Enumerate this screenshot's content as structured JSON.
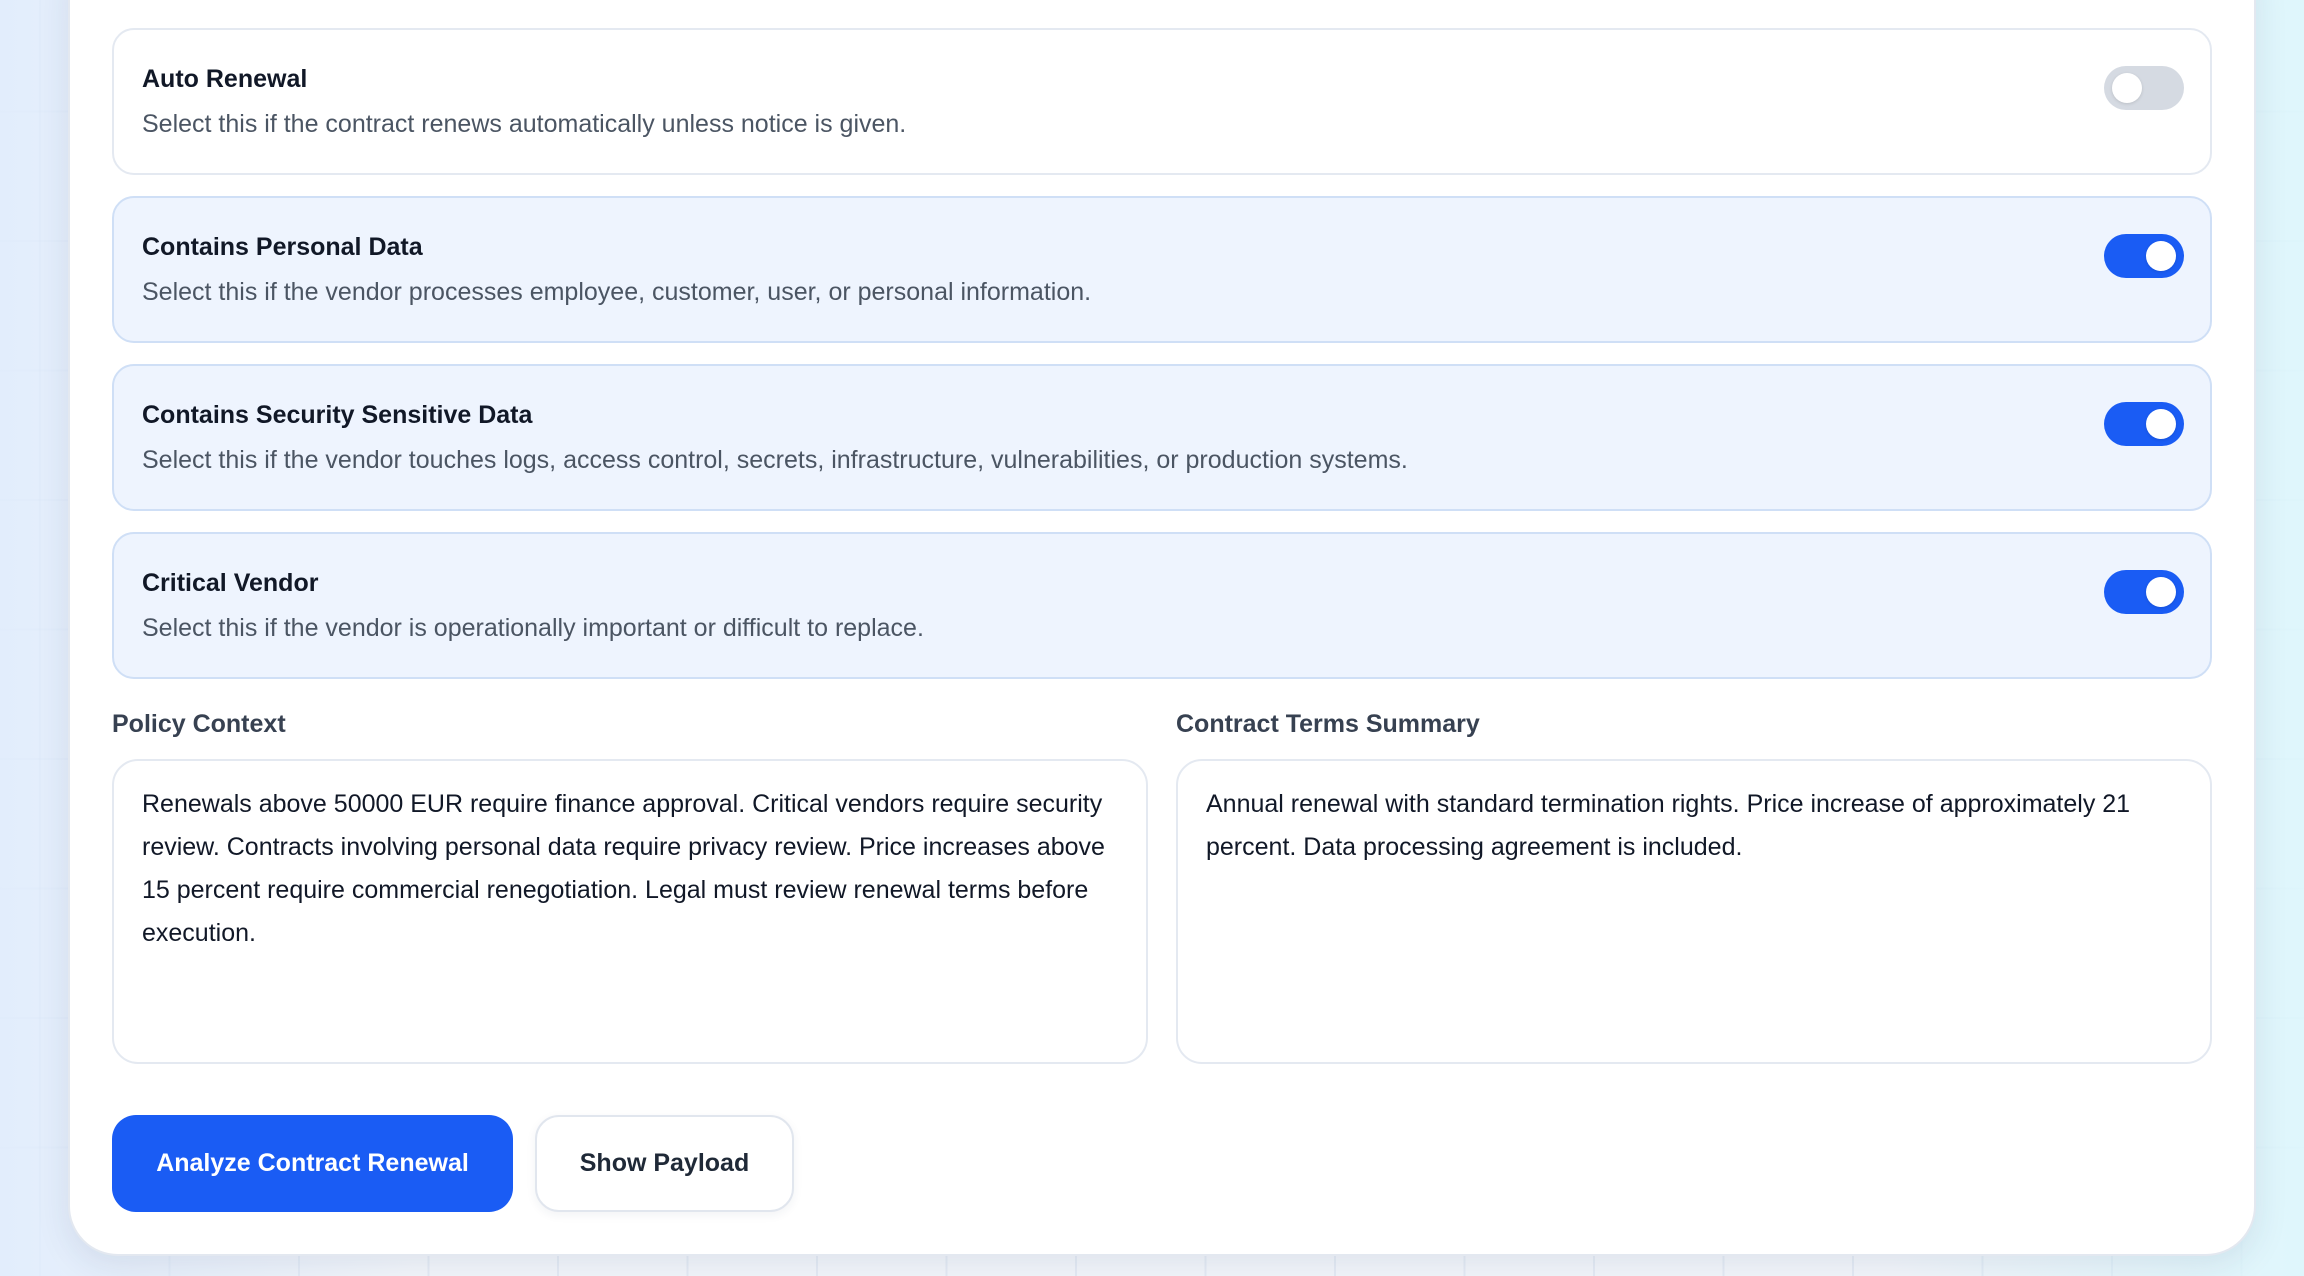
{
  "toggles": [
    {
      "title": "Auto Renewal",
      "description": "Select this if the contract renews automatically unless notice is given.",
      "enabled": false
    },
    {
      "title": "Contains Personal Data",
      "description": "Select this if the vendor processes employee, customer, user, or personal information.",
      "enabled": true
    },
    {
      "title": "Contains Security Sensitive Data",
      "description": "Select this if the vendor touches logs, access control, secrets, infrastructure, vulnerabilities, or production systems.",
      "enabled": true
    },
    {
      "title": "Critical Vendor",
      "description": "Select this if the vendor is operationally important or difficult to replace.",
      "enabled": true
    }
  ],
  "policy_context": {
    "label": "Policy Context",
    "value": "Renewals above 50000 EUR require finance approval. Critical vendors require security review. Contracts involving personal data require privacy review. Price increases above 15 percent require commercial renegotiation. Legal must review renewal terms before execution."
  },
  "contract_terms": {
    "label": "Contract Terms Summary",
    "value": "Annual renewal with standard termination rights. Price increase of approximately 21 percent. Data processing agreement is included."
  },
  "actions": {
    "analyze_label": "Analyze Contract Renewal",
    "payload_label": "Show Payload"
  },
  "colors": {
    "accent": "#1a5cf4",
    "toggle_off": "#d5dae2",
    "card_on_bg": "#eef4fe"
  }
}
